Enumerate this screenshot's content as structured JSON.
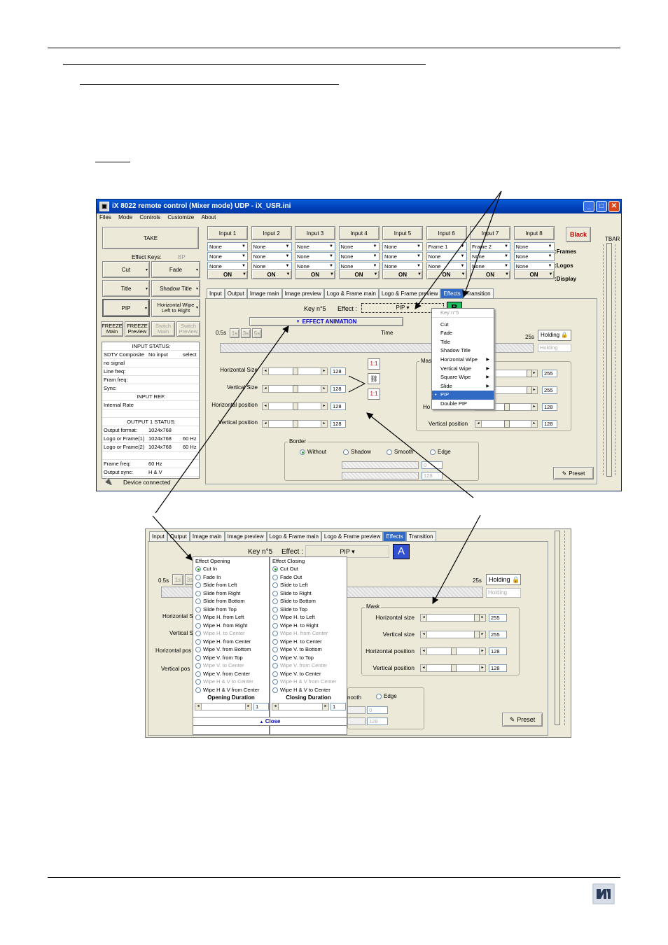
{
  "app": {
    "title": "iX 8022 remote control    (Mixer mode)  UDP - iX_USR.ini",
    "menu": [
      "Files",
      "Mode",
      "Controls",
      "Customize",
      "About"
    ],
    "left": {
      "take": "TAKE",
      "effect_keys_label": "Effect Keys:",
      "effect_keys_value": "BP",
      "effect_buttons": [
        "Cut",
        "Fade",
        "Title",
        "Shadow Title",
        "PIP",
        "Horizontal Wipe Left to Right"
      ],
      "freeze_buttons": [
        "FREEZE Main",
        "FREEZE Preview",
        "Switch Main",
        "Switch Preview"
      ],
      "status_rows": [
        [
          "INPUT STATUS:",
          "",
          ""
        ],
        [
          "SDTV Composite",
          "No input",
          "select"
        ],
        [
          "no signal",
          "",
          ""
        ],
        [
          "Line freq:",
          "",
          ""
        ],
        [
          "Fram freq:",
          "",
          ""
        ],
        [
          "Sync:",
          "",
          ""
        ],
        [
          "INPUT REF:",
          "",
          ""
        ],
        [
          "Internal Rate",
          "",
          ""
        ],
        [
          "",
          "",
          ""
        ],
        [
          "OUTPUT 1    STATUS:",
          "",
          ""
        ],
        [
          "Output format:",
          "1024x768",
          ""
        ],
        [
          "Logo or Frame(1)",
          "1024x768",
          "60 Hz"
        ],
        [
          "Logo or Frame(2)",
          "1024x768",
          "60 Hz"
        ],
        [
          "",
          "",
          ""
        ],
        [
          "Frame freq:",
          "60 Hz",
          ""
        ],
        [
          "Output sync:",
          "H & V",
          ""
        ]
      ],
      "device_status": "Device connected"
    },
    "inputs": [
      {
        "name": "Input 1",
        "rows": [
          "None",
          "None",
          "None"
        ],
        "on": "ON"
      },
      {
        "name": "Input 2",
        "rows": [
          "None",
          "None",
          "None"
        ],
        "on": "ON"
      },
      {
        "name": "Input 3",
        "rows": [
          "None",
          "None",
          "None"
        ],
        "on": "ON"
      },
      {
        "name": "Input 4",
        "rows": [
          "None",
          "None",
          "None"
        ],
        "on": "ON"
      },
      {
        "name": "Input 5",
        "rows": [
          "None",
          "None",
          "None"
        ],
        "on": "ON"
      },
      {
        "name": "Input 6",
        "rows": [
          "Frame 1",
          "None",
          "None"
        ],
        "on": "ON"
      },
      {
        "name": "Input 7",
        "rows": [
          "Frame 2",
          "None",
          "None"
        ],
        "on": "ON"
      },
      {
        "name": "Input 8",
        "rows": [
          "None",
          "None",
          "None"
        ],
        "on": "ON"
      }
    ],
    "black": "Black",
    "right_labels": [
      ":Frames",
      ":Logos",
      ":Display"
    ],
    "tbar": "TBAR",
    "tabs": [
      "Input",
      "Output",
      "Image main",
      "Image preview",
      "Logo & Frame main",
      "Logo & Frame preview",
      "Effects",
      "Transition"
    ],
    "effects": {
      "key_label": "Key n°5",
      "effect_label": "Effect :",
      "effect_value": "PIP",
      "key_letter": "B",
      "animation_button": "EFFECT ANIMATION",
      "time_start": "0.5s",
      "time_presets": [
        "1s",
        "3s",
        "5s"
      ],
      "time_label": "Time",
      "time_end": "25s",
      "holding_label": "Holding",
      "holding_value": "Holding",
      "sliders": [
        {
          "label": "Horizontal Size",
          "value": "128",
          "level": 0.5
        },
        {
          "label": "Vertical Size",
          "value": "128",
          "level": 0.5
        },
        {
          "label": "Horizontal position",
          "value": "128",
          "level": 0.5
        },
        {
          "label": "Vertical position",
          "value": "128",
          "level": 0.5
        }
      ],
      "mask_title": "Mask",
      "mask_values": [
        "255",
        "255",
        "128",
        "128"
      ],
      "mask_partial_labels": [
        "Ho",
        "Vertical position"
      ],
      "border_title": "Border",
      "border_options": [
        "Without",
        "Shadow",
        "Smooth",
        "Edge"
      ],
      "border_values": [
        "0",
        "128"
      ],
      "preset": "Preset",
      "dropdown_menu": [
        "Key n°5",
        "Cut",
        "Fade",
        "Title",
        "Shadow Title",
        "Horizontal Wipe",
        "Vertical Wipe",
        "Square Wipe",
        "Slide",
        "PIP",
        "Double PIP"
      ]
    }
  },
  "zoom": {
    "tabs": [
      "Input",
      "Output",
      "Image main",
      "Image preview",
      "Logo & Frame main",
      "Logo & Frame preview",
      "Effects",
      "Transition"
    ],
    "key_label": "Key n°5",
    "effect_label": "Effect :",
    "effect_value": "PIP",
    "key_letter": "A",
    "time_start": "0.5s",
    "time_presets": [
      "1s",
      "3s"
    ],
    "time_end": "25s",
    "holding_label": "Holding",
    "holding_value": "Holding",
    "partial_labels": [
      "Horizontal S",
      "Vertical S",
      "Horizontal pos",
      "Vertical pos"
    ],
    "opening_title": "Effect Opening",
    "closing_title": "Effect Closing",
    "opening_items": [
      {
        "t": "Cut In",
        "on": true,
        "dis": false
      },
      {
        "t": "Fade In",
        "on": false,
        "dis": false
      },
      {
        "t": "Slide from Left",
        "on": false,
        "dis": false
      },
      {
        "t": "Slide from Right",
        "on": false,
        "dis": false
      },
      {
        "t": "Slide from Bottom",
        "on": false,
        "dis": false
      },
      {
        "t": "Slide from Top",
        "on": false,
        "dis": false
      },
      {
        "t": "Wipe H. from Left",
        "on": false,
        "dis": false
      },
      {
        "t": "Wipe H. from Right",
        "on": false,
        "dis": false
      },
      {
        "t": "Wipe H. to Center",
        "on": false,
        "dis": true
      },
      {
        "t": "Wipe H. from Center",
        "on": false,
        "dis": false
      },
      {
        "t": "Wipe V. from Bottom",
        "on": false,
        "dis": false
      },
      {
        "t": "Wipe V. from Top",
        "on": false,
        "dis": false
      },
      {
        "t": "Wipe V. to Center",
        "on": false,
        "dis": true
      },
      {
        "t": "Wipe V. from Center",
        "on": false,
        "dis": false
      },
      {
        "t": "Wipe H & V to Center",
        "on": false,
        "dis": true
      },
      {
        "t": "Wipe H & V from Center",
        "on": false,
        "dis": false
      }
    ],
    "closing_items": [
      {
        "t": "Cut Out",
        "on": true,
        "dis": false
      },
      {
        "t": "Fade Out",
        "on": false,
        "dis": false
      },
      {
        "t": "Slide to Left",
        "on": false,
        "dis": false
      },
      {
        "t": "Slide to Right",
        "on": false,
        "dis": false
      },
      {
        "t": "Slide to Bottom",
        "on": false,
        "dis": false
      },
      {
        "t": "Slide to Top",
        "on": false,
        "dis": false
      },
      {
        "t": "Wipe H. to Left",
        "on": false,
        "dis": false
      },
      {
        "t": "Wipe H. to Right",
        "on": false,
        "dis": false
      },
      {
        "t": "Wipe H. from Center",
        "on": false,
        "dis": true
      },
      {
        "t": "Wipe H. to Center",
        "on": false,
        "dis": false
      },
      {
        "t": "Wipe V. to Bottom",
        "on": false,
        "dis": false
      },
      {
        "t": "Wipe V. to Top",
        "on": false,
        "dis": false
      },
      {
        "t": "Wipe V. from Center",
        "on": false,
        "dis": true
      },
      {
        "t": "Wipe V. to Center",
        "on": false,
        "dis": false
      },
      {
        "t": "Wipe H & V from Center",
        "on": false,
        "dis": true
      },
      {
        "t": "Wipe H & V to Center",
        "on": false,
        "dis": false
      }
    ],
    "opening_duration": "Opening Duration",
    "closing_duration": "Closing Duration",
    "opening_value": "1",
    "closing_value": "1",
    "close": "Close",
    "mask_title": "Mask",
    "mask_sliders": [
      {
        "label": "Horizontal size",
        "value": "255",
        "level": 0.95
      },
      {
        "label": "Vertical size",
        "value": "255",
        "level": 0.95
      },
      {
        "label": "Horizontal position",
        "value": "128",
        "level": 0.5
      },
      {
        "label": "Vertical position",
        "value": "128",
        "level": 0.5
      }
    ],
    "border_partial": "nooth",
    "edge": "Edge",
    "border_values": [
      "0",
      "128"
    ],
    "preset": "Preset"
  }
}
